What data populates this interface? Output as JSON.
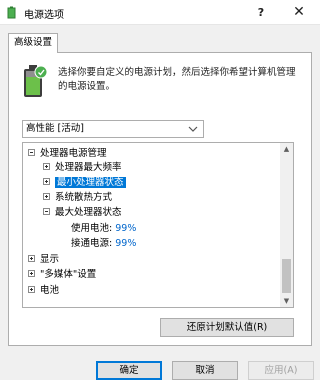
{
  "window": {
    "title": "电源选项",
    "help_label": "?",
    "close_label": "✕"
  },
  "tab": {
    "label": "高级设置"
  },
  "description": "选择你要自定义的电源计划，然后选择你希望计算机管理的电源设置。",
  "plan_select": {
    "value": "高性能 [活动]"
  },
  "tree": {
    "processor_mgmt": "处理器电源管理",
    "max_freq": "处理器最大频率",
    "min_state": "最小处理器状态",
    "cooling": "系统散热方式",
    "max_state": "最大处理器状态",
    "on_battery_label": "使用电池:",
    "on_battery_value": "99%",
    "plugged_in_label": "接通电源:",
    "plugged_in_value": "99%",
    "display": "显示",
    "multimedia": "\"多媒体\"设置",
    "battery": "电池"
  },
  "buttons": {
    "restore_defaults": "还原计划默认值(R)",
    "ok": "确定",
    "cancel": "取消",
    "apply": "应用(A)"
  },
  "colors": {
    "selection": "#0078d7",
    "value_text": "#0066cc"
  }
}
